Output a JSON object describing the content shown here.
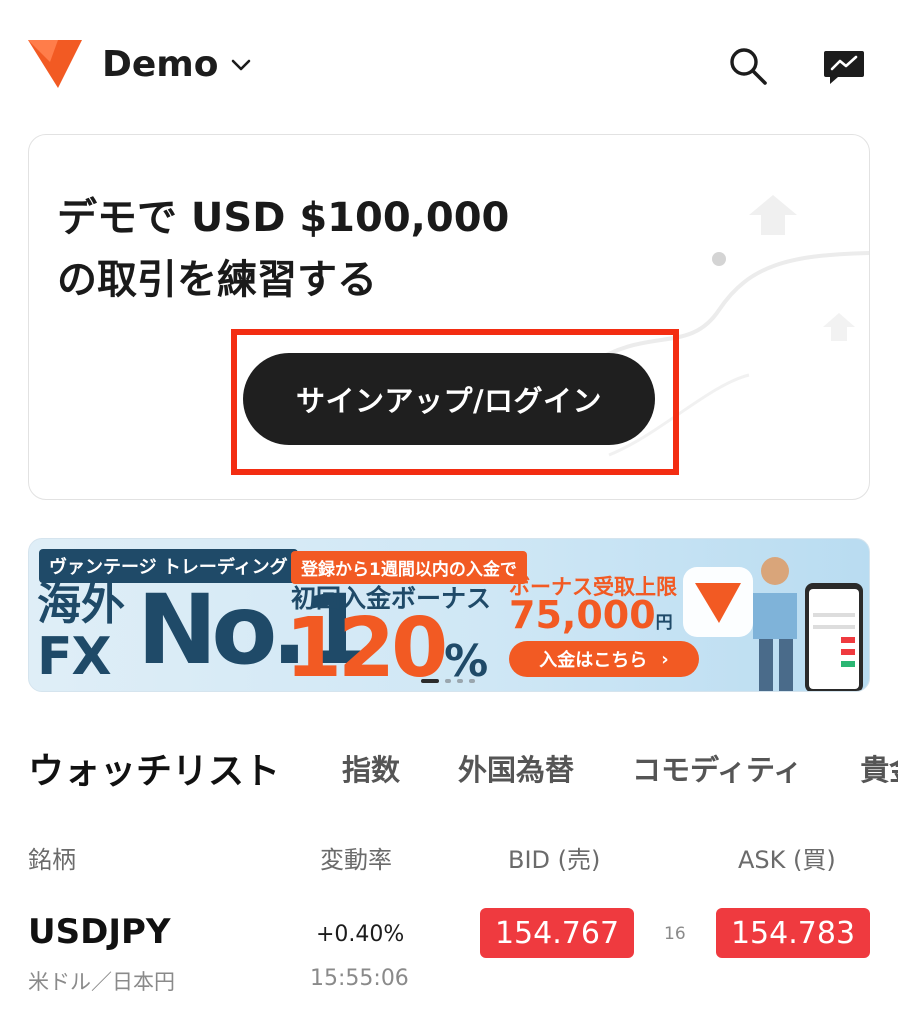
{
  "header": {
    "account_label": "Demo",
    "icons": [
      "logo-icon",
      "chevron-down-icon",
      "search-icon",
      "chat-icon"
    ]
  },
  "demo_card": {
    "title_line1": "デモで USD $100,000",
    "title_line2": "の取引を練習する",
    "signup_button": "サインアップ/ログイン",
    "highlight_color": "#f32d12"
  },
  "banner": {
    "tag": "ヴァンテージ トレーディング",
    "big_line1": "海外",
    "big_line2": "FX",
    "big_no1": "No.1",
    "subtitle": "登録から1週間以内の入金で",
    "first_deposit": "初回入金ボーナス",
    "percent_value": "120",
    "percent_sign": "%",
    "limit_label": "ボーナス受取上限",
    "limit_amount": "75,000",
    "limit_unit": "円",
    "cta": "入金はこちら",
    "cta_arrow": "›",
    "slide_count": 4,
    "active_slide": 1
  },
  "tabs": [
    {
      "label": "ウォッチリスト",
      "active": true
    },
    {
      "label": "指数",
      "active": false
    },
    {
      "label": "外国為替",
      "active": false
    },
    {
      "label": "コモディティ",
      "active": false
    },
    {
      "label": "貴金",
      "active": false
    }
  ],
  "table": {
    "headers": {
      "symbol": "銘柄",
      "change": "変動率",
      "bid": "BID (売)",
      "ask": "ASK (買)"
    },
    "rows": [
      {
        "symbol": "USDJPY",
        "name": "米ドル／日本円",
        "change": "+0.40%",
        "time": "15:55:06",
        "bid": "154.767",
        "spread": "16",
        "ask": "154.783"
      }
    ]
  },
  "colors": {
    "brand_orange": "#f25a23",
    "price_red": "#ef3a3f",
    "button_dark": "#1f1f1f"
  }
}
